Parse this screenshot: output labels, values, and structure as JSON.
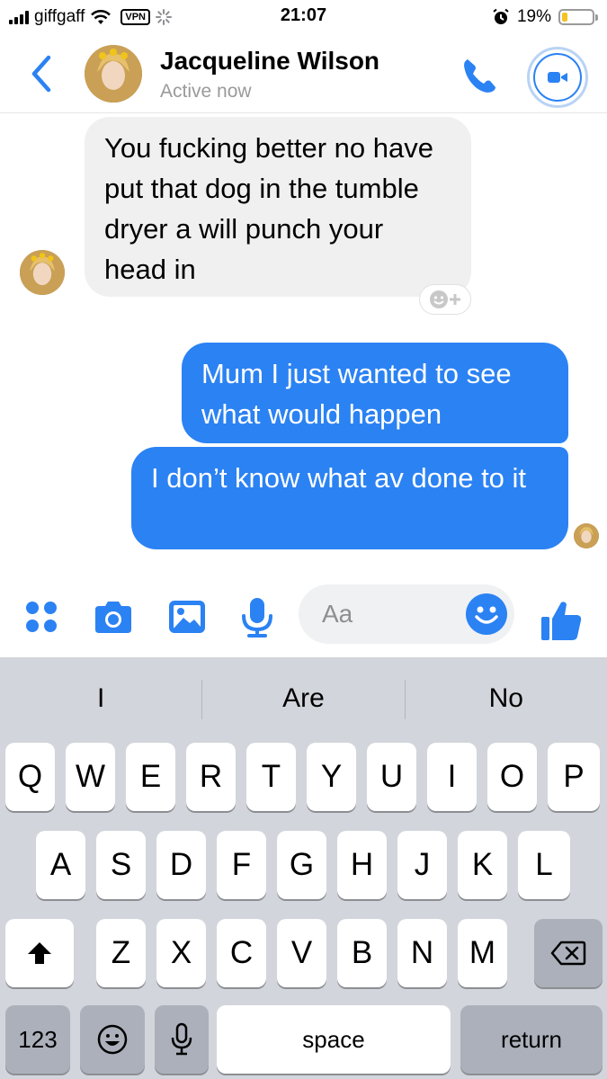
{
  "status_bar": {
    "carrier": "giffgaff",
    "vpn": "VPN",
    "time": "21:07",
    "battery": "19%",
    "battery_level": 0.19,
    "icons": [
      "signal-icon",
      "wifi-icon",
      "vpn-badge",
      "loading-spinner-icon",
      "alarm-icon",
      "battery-icon"
    ]
  },
  "header": {
    "contact_name": "Jacqueline Wilson",
    "status": "Active now",
    "icons": [
      "back-chevron-icon",
      "phone-icon",
      "video-camera-icon"
    ]
  },
  "messages": [
    {
      "direction": "incoming",
      "text": "You fucking better no have put that dog in the tumble dryer a will punch your head in"
    },
    {
      "direction": "outgoing",
      "text": "Mum I just wanted to see what would happen"
    },
    {
      "direction": "outgoing",
      "text": "I don’t know what av done to it"
    }
  ],
  "composer": {
    "placeholder": "Aa",
    "icons": [
      "apps-grid-icon",
      "camera-icon",
      "image-icon",
      "microphone-icon",
      "emoji-icon",
      "thumbs-up-icon"
    ]
  },
  "keyboard": {
    "suggestions": [
      "I",
      "Are",
      "No"
    ],
    "row1": [
      "Q",
      "W",
      "E",
      "R",
      "T",
      "Y",
      "U",
      "I",
      "O",
      "P"
    ],
    "row2": [
      "A",
      "S",
      "D",
      "F",
      "G",
      "H",
      "J",
      "K",
      "L"
    ],
    "row3": [
      "Z",
      "X",
      "C",
      "V",
      "B",
      "N",
      "M"
    ],
    "numbers_key": "123",
    "space_key": "space",
    "return_key": "return"
  },
  "colors": {
    "accent": "#2b82f3",
    "incoming_bubble": "#f0f0f0",
    "keyboard_bg": "#d2d5db"
  }
}
